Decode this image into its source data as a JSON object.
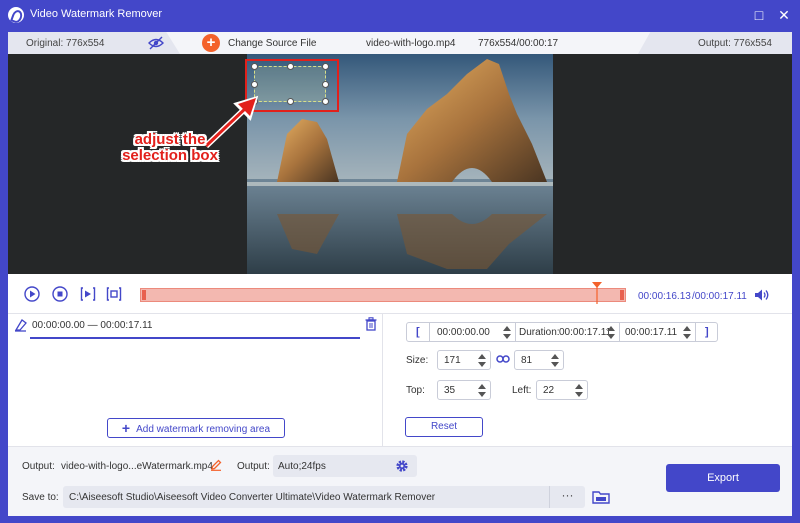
{
  "window": {
    "title": "Video Watermark Remover",
    "minimize": "□",
    "close": "✕"
  },
  "infobar": {
    "original": "Original: 776x554",
    "change_source": "Change Source File",
    "file_name": "video-with-logo.mp4",
    "file_meta": "776x554/00:00:17",
    "output": "Output: 776x554"
  },
  "annotation": {
    "line1": "adjust the",
    "line2": "selection box"
  },
  "playback": {
    "current_time": "00:00:16.13",
    "total_time": "/00:00:17.11",
    "progress_fraction": 0.93
  },
  "segment": {
    "range": "00:00:00.00 — 00:00:17.11"
  },
  "add_area_label": "Add watermark removing area",
  "time_range": {
    "start": "00:00:00.00",
    "duration_label": "Duration:",
    "duration": "00:00:17.11",
    "end": "00:00:17.11",
    "open_bracket": "[",
    "close_bracket": "]"
  },
  "size": {
    "label": "Size:",
    "width": "171",
    "height": "81"
  },
  "position": {
    "top_label": "Top:",
    "top": "35",
    "left_label": "Left:",
    "left": "22"
  },
  "reset_label": "Reset",
  "bottom": {
    "output_label": "Output:",
    "output_file": "video-with-logo...eWatermark.mp4",
    "format_label": "Output:",
    "format": "Auto;24fps",
    "save_label": "Save to:",
    "save_path": "C:\\Aiseesoft Studio\\Aiseesoft Video Converter Ultimate\\Video Watermark Remover",
    "more": "···",
    "export": "Export"
  },
  "colors": {
    "accent": "#4347c9",
    "annotation_red": "#e2201b",
    "timeline": "#f3b8b0",
    "orange": "#f4622b"
  }
}
